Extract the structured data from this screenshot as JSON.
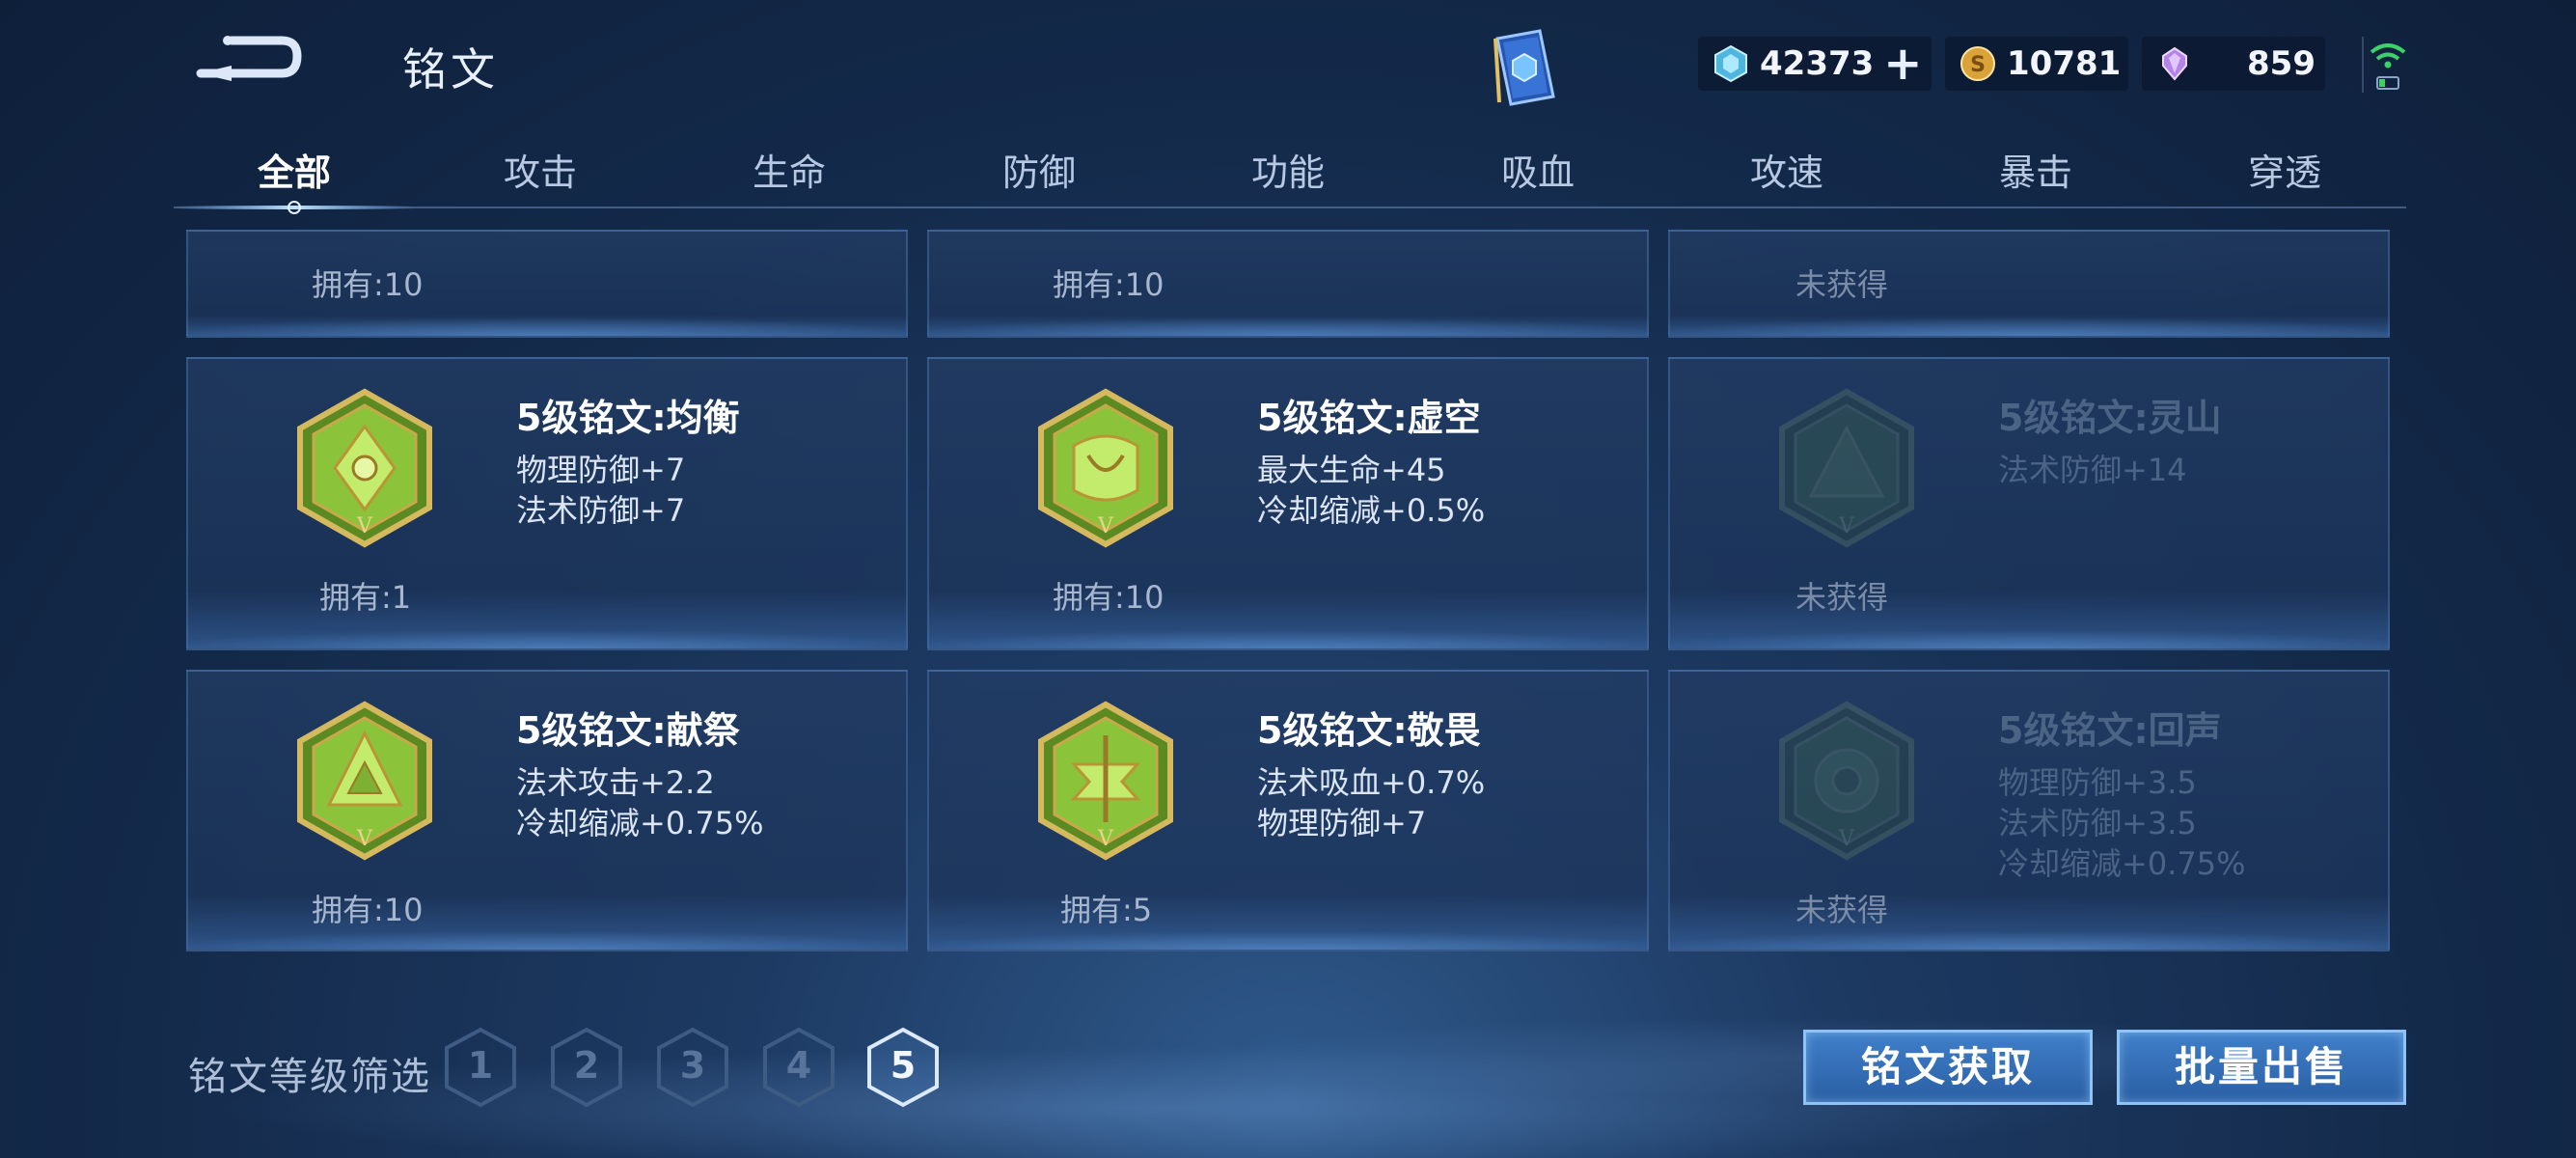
{
  "header": {
    "title": "铭文",
    "currencies": [
      {
        "name": "diamond",
        "value": "42373",
        "icon": "diamond-coupon-icon",
        "color": "#6fd2f0"
      },
      {
        "name": "gold",
        "value": "10781",
        "icon": "gold-coin-icon",
        "color": "#e3b24a"
      },
      {
        "name": "gem",
        "value": "859",
        "icon": "purple-gem-icon",
        "color": "#c79cf0"
      }
    ]
  },
  "tabs": [
    "全部",
    "攻击",
    "生命",
    "防御",
    "功能",
    "吸血",
    "攻速",
    "暴击",
    "穿透"
  ],
  "active_tab": "全部",
  "top_row": [
    {
      "owned": "拥有:10"
    },
    {
      "owned": "拥有:10"
    },
    {
      "owned": "未获得"
    }
  ],
  "runes": [
    {
      "name": "5级铭文:均衡",
      "stats": [
        "物理防御+7",
        "法术防御+7"
      ],
      "owned": "拥有:1",
      "locked": false,
      "icon": "balance-rune-icon"
    },
    {
      "name": "5级铭文:虚空",
      "stats": [
        "最大生命+45",
        "冷却缩减+0.5%"
      ],
      "owned": "拥有:10",
      "locked": false,
      "icon": "void-rune-icon"
    },
    {
      "name": "5级铭文:灵山",
      "stats": [
        "法术防御+14"
      ],
      "owned": "未获得",
      "locked": true,
      "icon": "spirit-mountain-rune-icon"
    },
    {
      "name": "5级铭文:献祭",
      "stats": [
        "法术攻击+2.2",
        "冷却缩减+0.75%"
      ],
      "owned": "拥有:10",
      "locked": false,
      "icon": "sacrifice-rune-icon"
    },
    {
      "name": "5级铭文:敬畏",
      "stats": [
        "法术吸血+0.7%",
        "物理防御+7"
      ],
      "owned": "拥有:5",
      "locked": false,
      "icon": "awe-rune-icon"
    },
    {
      "name": "5级铭文:回声",
      "stats": [
        "物理防御+3.5",
        "法术防御+3.5",
        "冷却缩减+0.75%"
      ],
      "owned": "未获得",
      "locked": true,
      "icon": "echo-rune-icon"
    }
  ],
  "filter": {
    "label": "铭文等级筛选",
    "levels": [
      "1",
      "2",
      "3",
      "4",
      "5"
    ],
    "selected": "5"
  },
  "actions": {
    "obtain": "铭文获取",
    "sell": "批量出售"
  },
  "colors": {
    "accent": "#8fc3f5",
    "rune_green": "#6fae2e",
    "rune_gold": "#c9a94a"
  }
}
